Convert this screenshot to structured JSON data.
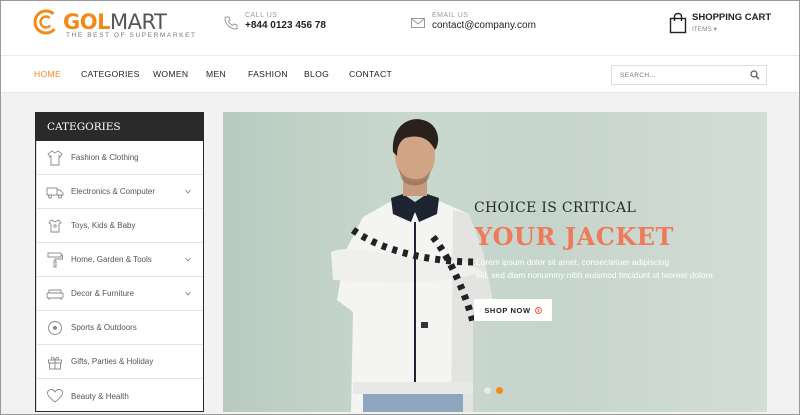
{
  "brand": {
    "name_part1": "GOL",
    "name_part2": "MART",
    "tagline": "THE BEST OF SUPERMARKET",
    "accent": "#f28a1a"
  },
  "header": {
    "phone": {
      "label": "CALL US",
      "value": "+844 0123 456 78",
      "icon": "phone-icon"
    },
    "email": {
      "label": "EMAIL US",
      "value": "contact@company.com",
      "icon": "envelope-icon"
    },
    "cart": {
      "title": "SHOPPING CART",
      "sub": "ITEMS",
      "icon": "shopping-bag-icon"
    }
  },
  "nav": {
    "items": [
      {
        "label": "HOME",
        "active": true
      },
      {
        "label": "CATEGORIES"
      },
      {
        "label": "WOMEN"
      },
      {
        "label": "MEN"
      },
      {
        "label": "FASHION"
      },
      {
        "label": "BLOG"
      },
      {
        "label": "CONTACT"
      }
    ],
    "search_placeholder": "SEARCH..."
  },
  "categories": {
    "title": "CATEGORIES",
    "items": [
      {
        "label": "Fashion & Clothing",
        "icon": "shirt-icon",
        "has_sub": false
      },
      {
        "label": "Electronics & Computer",
        "icon": "truck-icon",
        "has_sub": true
      },
      {
        "label": "Toys, Kids & Baby",
        "icon": "tshirt-icon",
        "has_sub": false
      },
      {
        "label": "Home, Garden & Tools",
        "icon": "paint-roller-icon",
        "has_sub": true
      },
      {
        "label": "Decor & Furniture",
        "icon": "sofa-icon",
        "has_sub": true
      },
      {
        "label": "Sports & Outdoors",
        "icon": "soccer-ball-icon",
        "has_sub": false
      },
      {
        "label": "Gifts, Parties & Holiday",
        "icon": "gift-icon",
        "has_sub": false
      },
      {
        "label": "Beauty & Health",
        "icon": "heart-icon",
        "has_sub": false
      }
    ]
  },
  "hero": {
    "subtitle": "CHOICE IS CRITICAL",
    "title": "YOUR JACKET",
    "body_line1": "Lorem ipsum dolor sit amet, consectetuer adipiscing",
    "body_line2": "elit, sed diam nonummy nibh euismod tincidunt ut laoreet dolore",
    "button": "SHOP NOW",
    "slides": 2,
    "active_slide": 2,
    "title_color": "#ef7a5a"
  }
}
